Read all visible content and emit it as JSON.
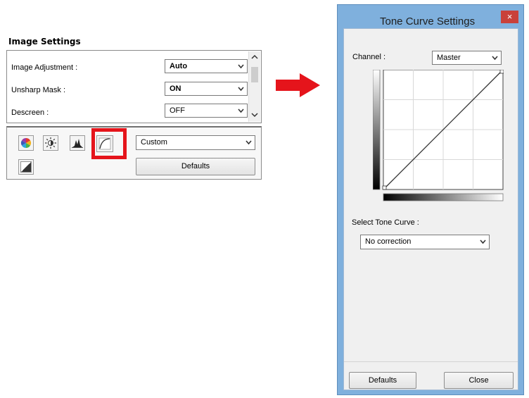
{
  "image_settings": {
    "title": "Image Settings",
    "rows": [
      {
        "label": "Image Adjustment :",
        "value": "Auto",
        "value_bold": true
      },
      {
        "label": "Unsharp Mask :",
        "value": "ON",
        "value_bold": true
      },
      {
        "label": "Descreen :",
        "value": "OFF",
        "value_bold": false
      }
    ],
    "preset_select": "Custom",
    "defaults_label": "Defaults",
    "tool_icons": [
      "color-balance-icon",
      "brightness-contrast-icon",
      "histogram-icon",
      "tone-curve-icon",
      "final-review-icon"
    ]
  },
  "tone_curve_window": {
    "title": "Tone Curve Settings",
    "close_symbol": "×",
    "channel_label": "Channel :",
    "channel_value": "Master",
    "select_tone_curve_label": "Select Tone Curve :",
    "tone_curve_value": "No correction",
    "defaults_label": "Defaults",
    "close_label": "Close"
  },
  "colors": {
    "highlight": "#e5141b",
    "arrow": "#e5141b",
    "window_frame": "#7fb0dd",
    "close_button": "#c9413a"
  }
}
